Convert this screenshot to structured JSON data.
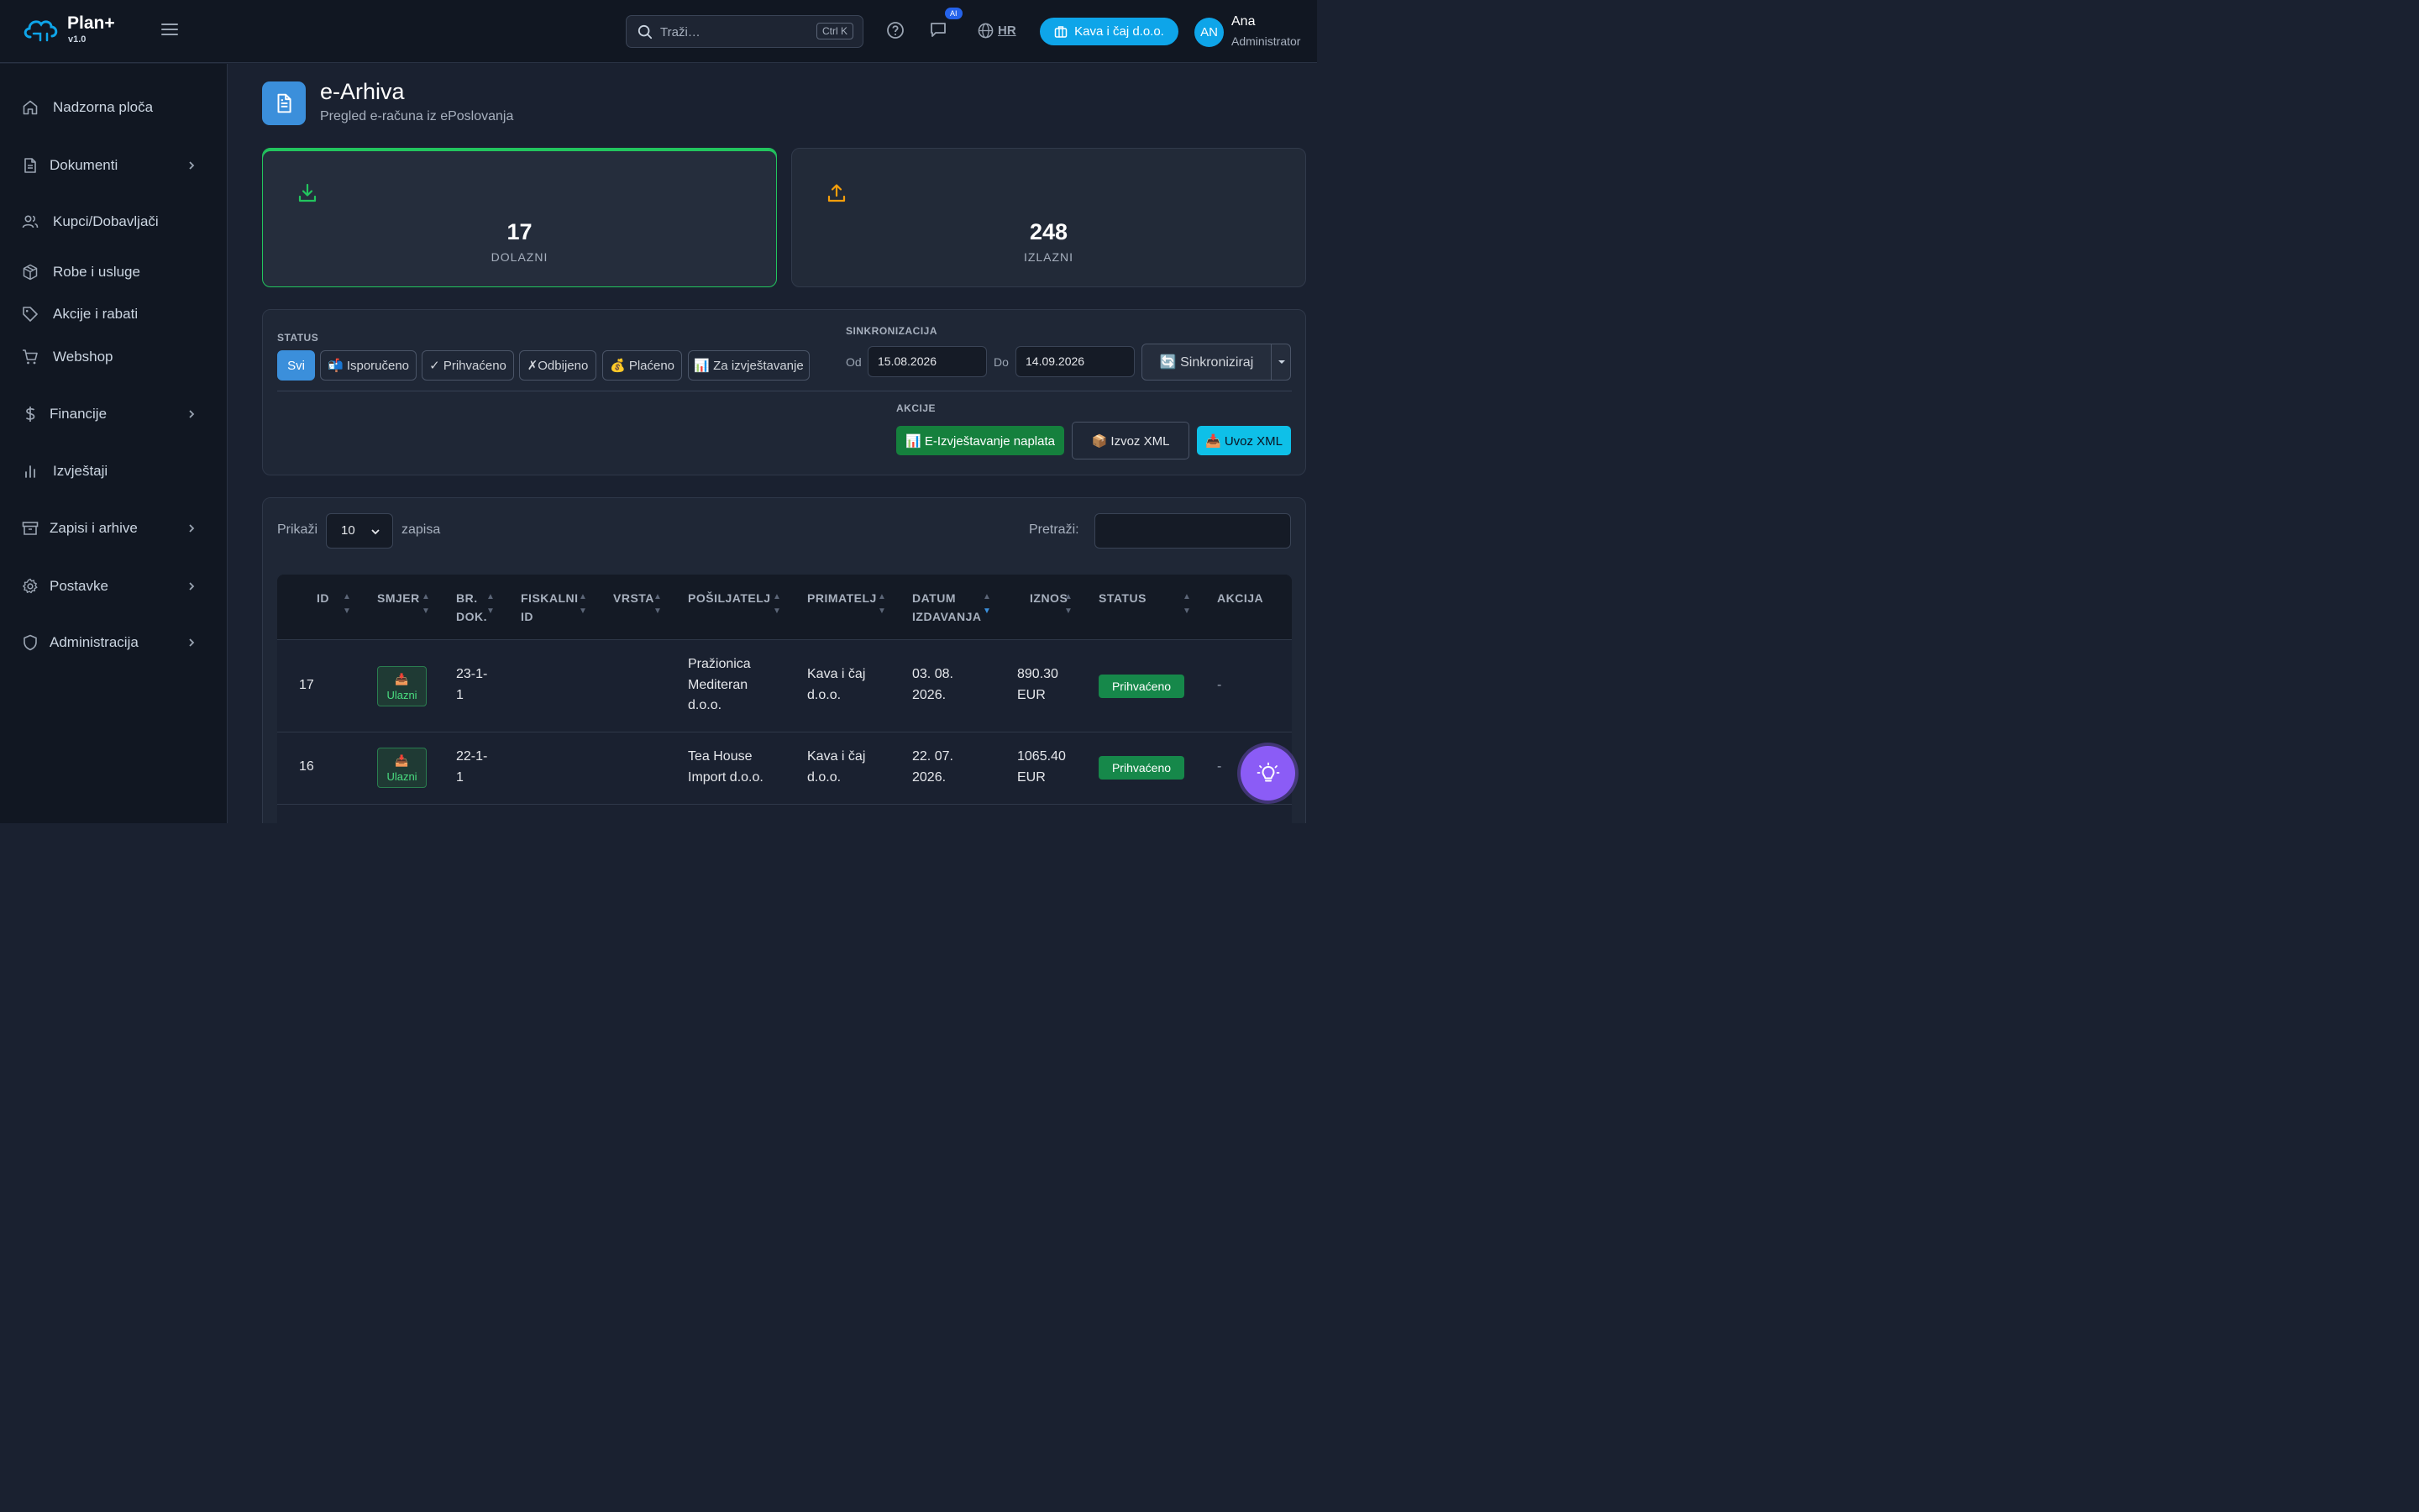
{
  "app": {
    "name": "Plan+",
    "version": "v1.0"
  },
  "topbar": {
    "search_placeholder": "Traži…",
    "search_shortcut": "Ctrl K",
    "ai_badge": "AI",
    "language": "HR",
    "company": "Kava i čaj d.o.o.",
    "user_initials": "AN",
    "user_name": "Ana",
    "user_role": "Administrator"
  },
  "sidebar": {
    "items": [
      {
        "label": "Nadzorna ploča",
        "icon": "home-icon"
      },
      {
        "label": "Dokumenti",
        "icon": "document-icon",
        "expandable": true
      },
      {
        "label": "Kupci/Dobavljači",
        "icon": "users-icon"
      },
      {
        "label": "Robe i usluge",
        "icon": "package-icon"
      },
      {
        "label": "Akcije i rabati",
        "icon": "tag-icon"
      },
      {
        "label": "Webshop",
        "icon": "cart-icon"
      },
      {
        "label": "Financije",
        "icon": "dollar-icon",
        "expandable": true
      },
      {
        "label": "Izvještaji",
        "icon": "bar-chart-icon"
      },
      {
        "label": "Zapisi i arhive",
        "icon": "archive-icon",
        "expandable": true
      },
      {
        "label": "Postavke",
        "icon": "gear-icon",
        "expandable": true
      },
      {
        "label": "Administracija",
        "icon": "shield-icon",
        "expandable": true
      }
    ]
  },
  "page": {
    "title": "e-Arhiva",
    "subtitle": "Pregled e-računa iz ePoslovanja"
  },
  "stats": [
    {
      "value": "17",
      "label": "DOLAZNI",
      "active": true,
      "icon": "download-icon",
      "color": "#22c55e"
    },
    {
      "value": "248",
      "label": "IZLAZNI",
      "active": false,
      "icon": "upload-icon",
      "color": "#f59e0b"
    }
  ],
  "filters": {
    "status_label": "STATUS",
    "chips": [
      {
        "label": "Svi",
        "active": true
      },
      {
        "label": "📬 Isporučeno"
      },
      {
        "label": "✓ Prihvaćeno"
      },
      {
        "label": "✗Odbijeno"
      },
      {
        "label": "💰 Plaćeno"
      },
      {
        "label": "📊 Za izvještavanje"
      }
    ],
    "sync_label": "SINKRONIZACIJA",
    "from_label": "Od",
    "from_value": "15.08.2026",
    "to_label": "Do",
    "to_value": "14.09.2026",
    "sync_button": "🔄 Sinkroniziraj",
    "actions_label": "AKCIJE",
    "actions": [
      {
        "label": "📊 E-Izvještavanje naplata",
        "color": "#15803d"
      },
      {
        "label": "📦 Izvoz XML",
        "color": "#1f2736"
      },
      {
        "label": "📥 Uvoz XML",
        "color": "#0ec0e8"
      }
    ]
  },
  "table": {
    "show_label": "Prikaži",
    "page_size": "10",
    "records_label": "zapisa",
    "search_label": "Pretraži:",
    "columns": [
      {
        "line1": "",
        "line2": "ID"
      },
      {
        "line1": "",
        "line2": "SMJER"
      },
      {
        "line1": "BR.",
        "line2": "DOK."
      },
      {
        "line1": "FISKALNI",
        "line2": "ID"
      },
      {
        "line1": "",
        "line2": "VRSTA"
      },
      {
        "line1": "",
        "line2": "POŠILJATELJ"
      },
      {
        "line1": "",
        "line2": "PRIMATELJ"
      },
      {
        "line1": "DATUM",
        "line2": "IZDAVANJA"
      },
      {
        "line1": "",
        "line2": "IZNOS"
      },
      {
        "line1": "",
        "line2": "STATUS"
      },
      {
        "line1": "",
        "line2": "AKCIJA"
      }
    ],
    "rows": [
      {
        "id": "17",
        "direction": "📥 Ulazni",
        "doc_no": [
          "23-1-",
          "1"
        ],
        "fiscal_id": "",
        "type": "",
        "sender": [
          "Pražionica",
          "Mediteran",
          "d.o.o."
        ],
        "recipient": [
          "Kava i čaj",
          "d.o.o."
        ],
        "date": [
          "03. 08.",
          "2026."
        ],
        "amount": [
          "890.30",
          "EUR"
        ],
        "status": "Prihvaćeno",
        "action": "-"
      },
      {
        "id": "16",
        "direction": "📥 Ulazni",
        "doc_no": [
          "22-1-",
          "1"
        ],
        "fiscal_id": "",
        "type": "",
        "sender": [
          "Tea House",
          "Import d.o.o."
        ],
        "recipient": [
          "Kava i čaj",
          "d.o.o."
        ],
        "date": [
          "22. 07.",
          "2026."
        ],
        "amount": [
          "1065.40",
          "EUR"
        ],
        "status": "Prihvaćeno",
        "action": "-"
      }
    ]
  },
  "colors": {
    "accent": "#3b8fdb",
    "brand": "#0ea5e9",
    "success": "#16884a",
    "fab": "#8b5cf6"
  }
}
